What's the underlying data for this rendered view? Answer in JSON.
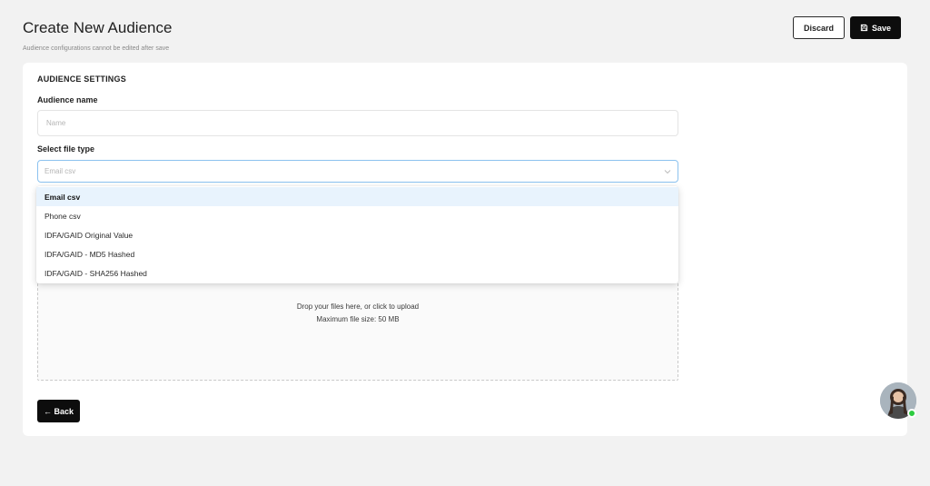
{
  "header": {
    "title": "Create New Audience",
    "subtitle": "Audience configurations cannot be edited after save",
    "discard_label": "Discard",
    "save_label": "Save"
  },
  "settings": {
    "section_title": "AUDIENCE SETTINGS",
    "name_label": "Audience name",
    "name_placeholder": "Name",
    "file_type_label": "Select file type",
    "file_type_selected": "Email csv"
  },
  "dropdown": {
    "options": [
      "Email csv",
      "Phone csv",
      "IDFA/GAID Original Value",
      "IDFA/GAID - MD5 Hashed",
      "IDFA/GAID - SHA256 Hashed"
    ]
  },
  "upload": {
    "text": "Drop your files here, or click to upload",
    "subtext": "Maximum file size: 50 MB"
  },
  "back_label": "← Back",
  "icons": {
    "save": "save-icon",
    "chevron": "chevron-down-icon",
    "upload": "upload-icon"
  },
  "colors": {
    "accent": "#2f80ed",
    "primary_button": "#0d0d0d",
    "active_option": "#e8f3fd",
    "online": "#2ecc40"
  }
}
